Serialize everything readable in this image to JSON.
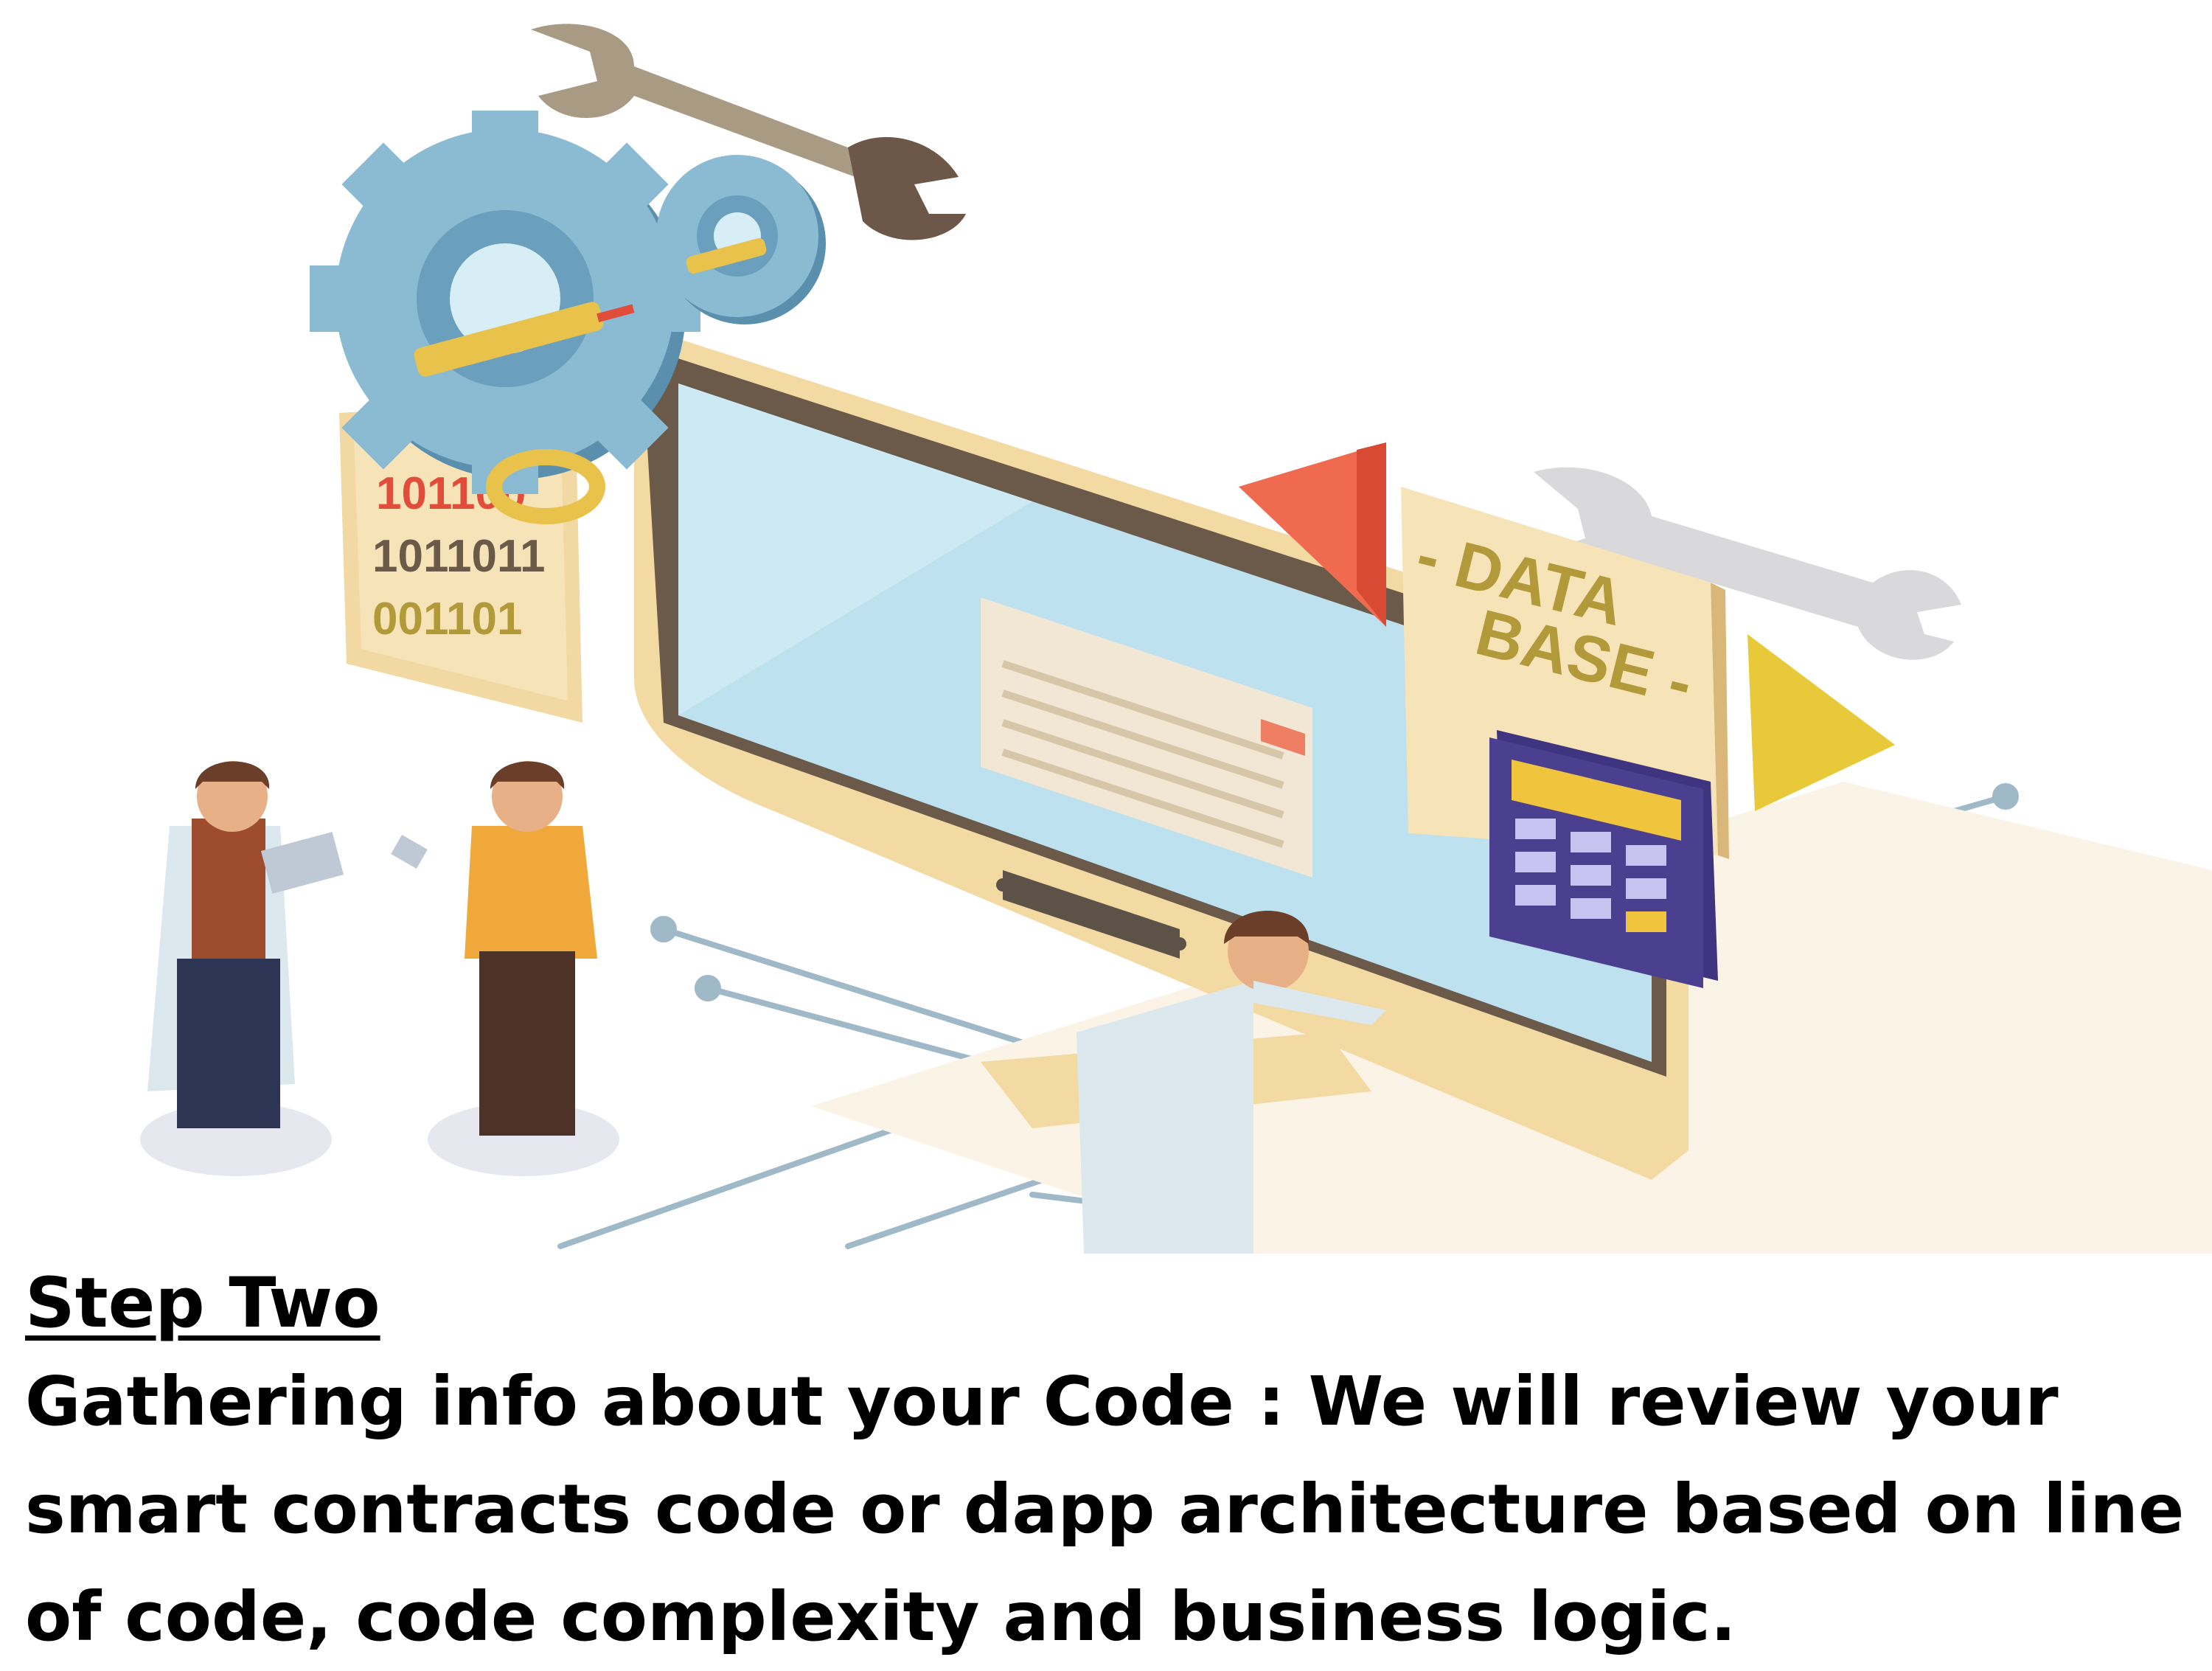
{
  "illustration": {
    "binary_lines": [
      "101100",
      "1011011",
      "001101"
    ],
    "database_label": [
      "- DATA",
      "BASE -"
    ],
    "colors": {
      "gear": "#6fa6c4",
      "screen": "#bde1ee",
      "monitor_frame": "#f3d9a2",
      "arrow_red": "#f06a4f",
      "arrow_yellow": "#e8c93a",
      "calculator": "#4b3f8f",
      "wrench": "#8b7b6a"
    },
    "icons": [
      "wrench-icon",
      "gear-icon",
      "key-icon",
      "monitor-icon",
      "database-icon",
      "calculator-icon",
      "arrow-left-icon",
      "arrow-right-icon"
    ]
  },
  "caption": {
    "title": "Step Two",
    "description": "Gathering info about your Code : We will review your smart contracts code or dapp architecture based on line of code, code complexity and business logic."
  }
}
